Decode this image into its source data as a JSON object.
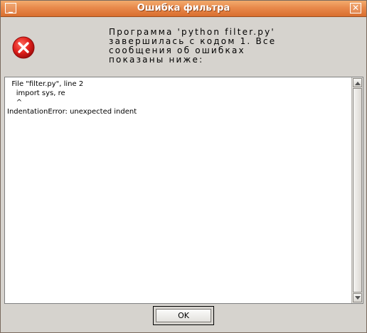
{
  "window": {
    "title": "Ошибка фильтра",
    "minimize_glyph": "_",
    "close_glyph": "✕"
  },
  "dialog": {
    "icon": "error-icon",
    "message": "Программа 'python filter.py'\nзавершилась с кодом 1. Все\nсообщения об ошибках\nпоказаны ниже:",
    "details": "  File \"filter.py\", line 2\n    import sys, re\n    ^\nIndentationError: unexpected indent",
    "ok_label": "OK"
  },
  "colors": {
    "titlebar": "#e8894b",
    "error_red": "#d7161b",
    "background": "#d6d3ce"
  }
}
